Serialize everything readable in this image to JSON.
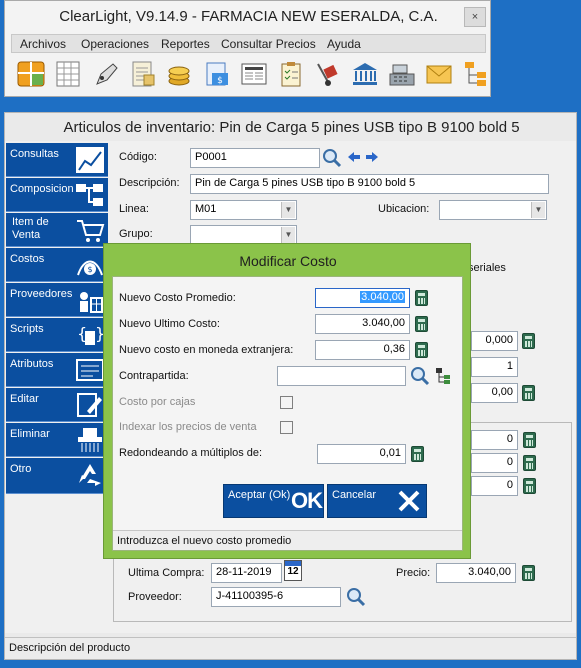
{
  "app": {
    "title": "ClearLight, V9.14.9 - FARMACIA NEW ESERALDA, C.A.",
    "close": "×",
    "menu": [
      "Archivos",
      "Operaciones",
      "Reportes",
      "Consultar Precios",
      "Ayuda"
    ],
    "toolbar_icons": [
      "spreadsheet-icon",
      "grid-icon",
      "pen-icon",
      "document-list-icon",
      "coins-icon",
      "invoice-icon",
      "newspaper-icon",
      "checklist-icon",
      "hand-truck-icon",
      "bank-icon",
      "cash-register-icon",
      "mail-icon",
      "tree-structure-icon"
    ]
  },
  "form": {
    "title": "Articulos de inventario: Pin de Carga 5 pines USB tipo B 9100 bold 5",
    "sidebar": [
      {
        "label": "Consultas",
        "icon": "chart-icon"
      },
      {
        "label": "Composicion",
        "icon": "hierarchy-icon"
      },
      {
        "label": "Item de Venta",
        "icon": "cart-icon"
      },
      {
        "label": "Costos",
        "icon": "costs-icon"
      },
      {
        "label": "Proveedores",
        "icon": "supplier-icon"
      },
      {
        "label": "Scripts",
        "icon": "script-icon"
      },
      {
        "label": "Atributos",
        "icon": "attributes-icon"
      },
      {
        "label": "Editar",
        "icon": "edit-icon"
      },
      {
        "label": "Eliminar",
        "icon": "shredder-icon"
      },
      {
        "label": "Otro",
        "icon": "recycle-icon"
      }
    ],
    "codigo_label": "Código:",
    "codigo_value": "P0001",
    "descripcion_label": "Descripción:",
    "descripcion_value": "Pin de Carga 5 pines USB tipo B 9100 bold 5",
    "linea_label": "Linea:",
    "linea_value": "M01",
    "ubicacion_label": "Ubicacion:",
    "ubicacion_value": "",
    "grupo_label": "Grupo:",
    "grupo_value": "",
    "seriales_text": "seriales",
    "right_values": [
      "0,000",
      "1",
      "0,00"
    ],
    "box_values": [
      "0",
      "0",
      "0"
    ],
    "ultima_compra_label": "Ultima Compra:",
    "ultima_compra_value": "28-11-2019",
    "calendar_day": "12",
    "precio_label": "Precio:",
    "precio_value": "3.040,00",
    "proveedor_label": "Proveedor:",
    "proveedor_value": "J-41100395-6",
    "status": "Descripción del producto"
  },
  "modal": {
    "title": "Modificar Costo",
    "nuevo_costo_promedio_label": "Nuevo Costo Promedio:",
    "nuevo_costo_promedio_value": "3.040,00",
    "nuevo_ultimo_costo_label": "Nuevo Ultimo Costo:",
    "nuevo_ultimo_costo_value": "3.040,00",
    "moneda_extranjera_label": "Nuevo costo en moneda extranjera:",
    "moneda_extranjera_value": "0,36",
    "contrapartida_label": "Contrapartida:",
    "contrapartida_value": "",
    "costo_por_cajas_label": "Costo por cajas",
    "indexar_label": "Indexar los precios de venta",
    "redondeando_label": "Redondeando a múltiplos de:",
    "redondeando_value": "0,01",
    "accept_label": "Aceptar (Ok)",
    "accept_mark": "OK",
    "cancel_label": "Cancelar",
    "status": "Introduzca el nuevo costo promedio"
  }
}
